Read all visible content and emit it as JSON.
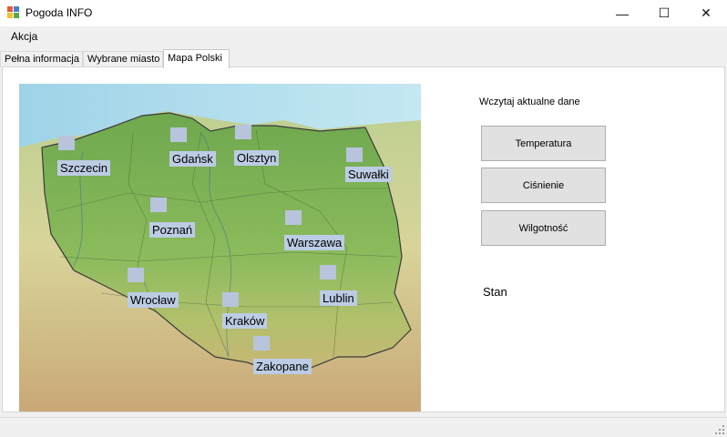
{
  "window": {
    "title": "Pogoda INFO",
    "minimize_glyph": "—",
    "maximize_glyph": "☐",
    "close_glyph": "✕"
  },
  "menu": {
    "items": [
      {
        "label": "Akcja"
      }
    ]
  },
  "tabs": [
    {
      "label": "Pełna informacja",
      "active": false
    },
    {
      "label": "Wybrane miasto",
      "active": false
    },
    {
      "label": "Mapa Polski",
      "active": true
    }
  ],
  "map": {
    "cities": [
      {
        "name": "Szczecin"
      },
      {
        "name": "Gdańsk"
      },
      {
        "name": "Olsztyn"
      },
      {
        "name": "Suwałki"
      },
      {
        "name": "Poznań"
      },
      {
        "name": "Warszawa"
      },
      {
        "name": "Wrocław"
      },
      {
        "name": "Lublin"
      },
      {
        "name": "Kraków"
      },
      {
        "name": "Zakopane"
      }
    ]
  },
  "panel": {
    "load_label": "Wczytaj aktualne dane",
    "buttons": {
      "temperature": "Temperatura",
      "pressure": "Ciśnienie",
      "humidity": "Wilgotność"
    },
    "status_label": "Stan"
  },
  "colors": {
    "marker": "#b8c4dc",
    "label_bg": "#bccce4",
    "land": "#7fae5c",
    "sea": "#a8d8ea"
  }
}
